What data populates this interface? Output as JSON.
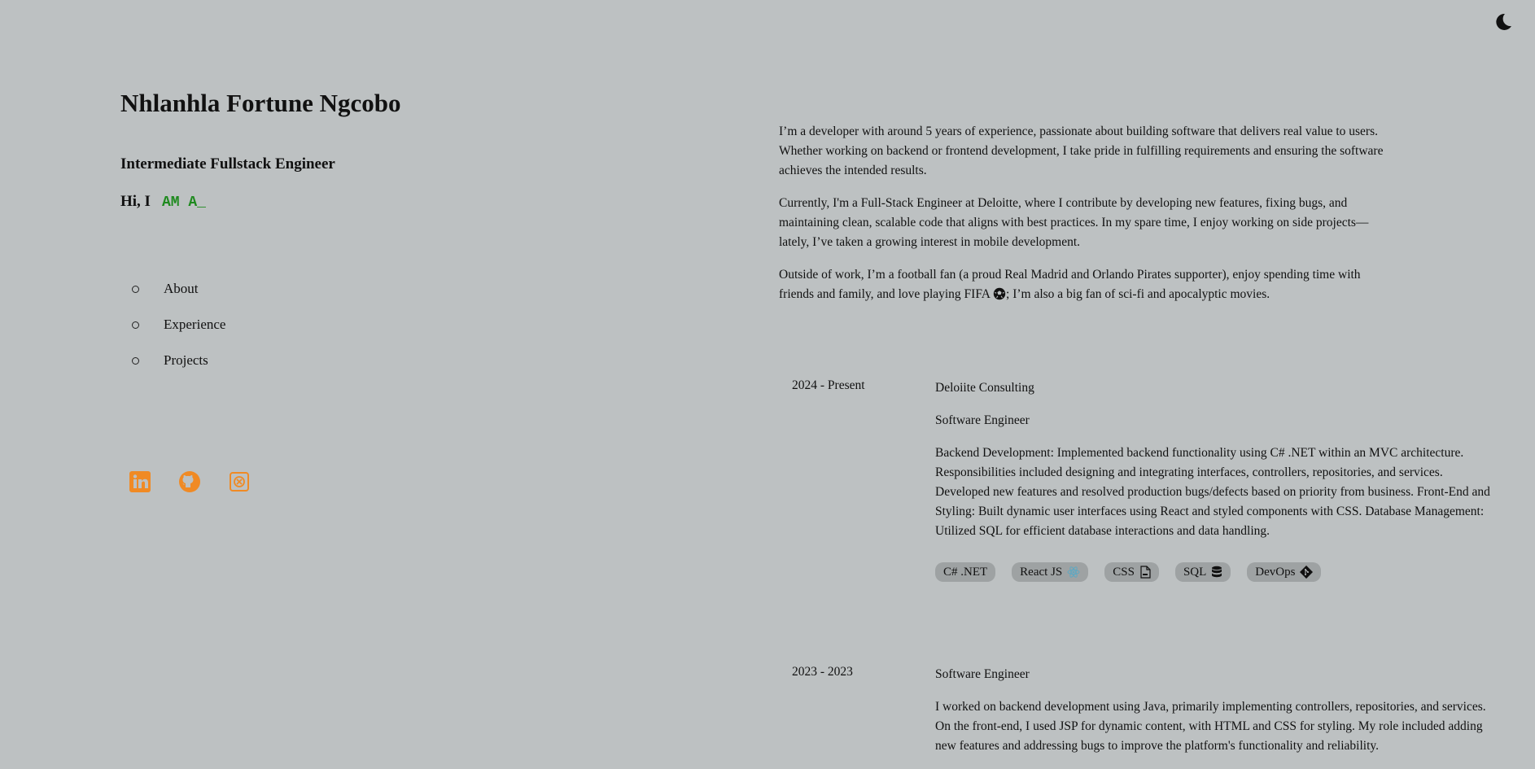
{
  "header": {
    "theme_toggle_icon": "moon-icon"
  },
  "profile": {
    "name": "Nhlanhla Fortune Ngcobo",
    "title": "Intermediate Fullstack Engineer",
    "greeting": "Hi, I",
    "typed_text": "AM A_"
  },
  "nav": {
    "items": [
      {
        "label": "About"
      },
      {
        "label": "Experience"
      },
      {
        "label": "Projects"
      }
    ]
  },
  "socials": [
    {
      "icon": "linkedin-icon"
    },
    {
      "icon": "github-icon"
    },
    {
      "icon": "sololearn-icon"
    }
  ],
  "about": {
    "p1": "I’m a developer with around 5 years of experience, passionate about building software that delivers real value to users. Whether working on backend or frontend development, I take pride in fulfilling requirements and ensuring the software achieves the intended results.",
    "p2": "Currently, I'm a Full-Stack Engineer at Deloitte, where I contribute by developing new features, fixing bugs, and maintaining clean, scalable code that aligns with best practices. In my spare time, I enjoy working on side projects—lately, I’ve taken a growing interest in mobile development.",
    "p3a": "Outside of work, I’m a football fan (a proud Real Madrid and Orlando Pirates supporter), enjoy spending time with friends and family, and love playing FIFA",
    "p3b": "; I’m also a big fan of sci-fi and apocalyptic movies."
  },
  "experience": [
    {
      "date": "2024 - Present",
      "company": "Deloiite Consulting",
      "role": "Software Engineer",
      "description": "Backend Development: Implemented backend functionality using C# .NET within an MVC architecture. Responsibilities included designing and integrating interfaces, controllers, repositories, and services. Developed new features and resolved production bugs/defects based on priority from business. Front-End and Styling: Built dynamic user interfaces using React and styled components with CSS. Database Management: Utilized SQL for efficient database interactions and data handling.",
      "tags": [
        {
          "label": "C# .NET"
        },
        {
          "label": "React JS",
          "icon": "react-icon"
        },
        {
          "label": "CSS",
          "icon": "css-file-icon"
        },
        {
          "label": "SQL",
          "icon": "database-icon"
        },
        {
          "label": "DevOps",
          "icon": "git-icon"
        }
      ]
    },
    {
      "date": "2023 - 2023",
      "role": "Software Engineer",
      "description": "I worked on backend development using Java, primarily implementing controllers, repositories, and services. On the front-end, I used JSP for dynamic content, with HTML and CSS for styling. My role included adding new features and addressing bugs to improve the platform's functionality and reliability."
    }
  ],
  "colors": {
    "background": "#bdc1c2",
    "accent": "#f08a24",
    "typed": "#1e8a1e",
    "tag_bg": "#9ea2a3"
  }
}
